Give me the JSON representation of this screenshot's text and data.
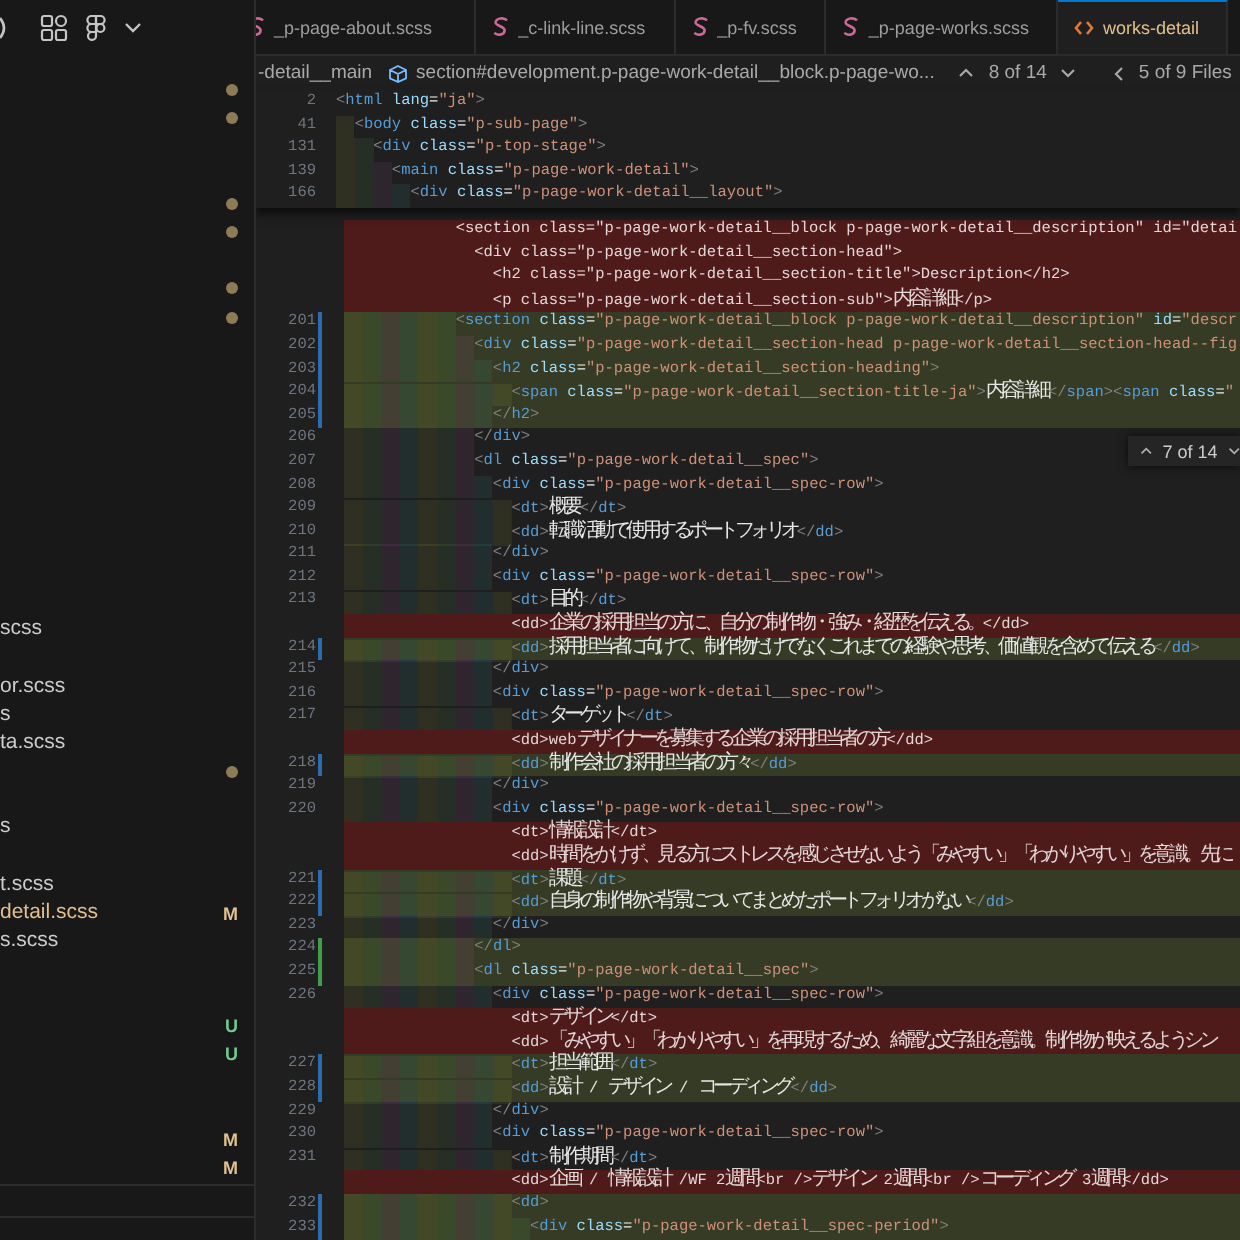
{
  "tabs": [
    {
      "label": "_p-page-about.scss",
      "kind": "scss",
      "selected": false
    },
    {
      "label": "_c-link-line.scss",
      "kind": "scss",
      "selected": false
    },
    {
      "label": "_p-fv.scss",
      "kind": "scss",
      "selected": false
    },
    {
      "label": "_p-page-works.scss",
      "kind": "scss",
      "selected": false
    },
    {
      "label": "works-detail",
      "kind": "html",
      "selected": true
    }
  ],
  "explorer": {
    "rows": [
      {
        "kind": "dot"
      },
      {
        "kind": "dot"
      },
      {
        "kind": "blank"
      },
      {
        "kind": "blank"
      },
      {
        "kind": "dot"
      },
      {
        "kind": "dot"
      },
      {
        "kind": "blank"
      },
      {
        "kind": "dot"
      },
      {
        "kind": "dot"
      },
      {
        "kind": "blank"
      },
      {
        "kind": "blank"
      },
      {
        "kind": "blank"
      },
      {
        "kind": "blank"
      },
      {
        "kind": "blank"
      },
      {
        "kind": "blank"
      },
      {
        "kind": "blank"
      },
      {
        "kind": "blank"
      },
      {
        "kind": "blank"
      },
      {
        "kind": "blank"
      },
      {
        "kind": "file",
        "label": "scss"
      },
      {
        "kind": "blank"
      },
      {
        "kind": "file",
        "label": "or.scss"
      },
      {
        "kind": "file",
        "label": "s"
      },
      {
        "kind": "file",
        "label": "ta.scss"
      },
      {
        "kind": "dot"
      },
      {
        "kind": "blank"
      },
      {
        "kind": "file",
        "label": "s"
      },
      {
        "kind": "blank"
      },
      {
        "kind": "file",
        "label": "t.scss"
      },
      {
        "kind": "file",
        "label": "detail.scss",
        "status": "M"
      },
      {
        "kind": "file",
        "label": "s.scss"
      },
      {
        "kind": "blank"
      },
      {
        "kind": "blank"
      },
      {
        "kind": "file",
        "status": "U"
      },
      {
        "kind": "file",
        "status": "U"
      },
      {
        "kind": "blank"
      },
      {
        "kind": "blank"
      },
      {
        "kind": "file",
        "status": "M"
      },
      {
        "kind": "file",
        "status": "M"
      }
    ]
  },
  "breadcrumb": [
    {
      "kind": "text",
      "label": "-detail__main"
    },
    {
      "kind": "element",
      "label": "section#development.p-page-work-detail__block.p-page-wo..."
    }
  ],
  "change_nav": {
    "position": "8 of 14"
  },
  "file_nav": {
    "position": "5 of 9 Files"
  },
  "sticky_scroll": [
    {
      "number": "2",
      "code": "<html lang=\"ja\">"
    },
    {
      "number": "41",
      "code": "  <body class=\"p-sub-page\">"
    },
    {
      "number": "131",
      "code": "    <div class=\"p-top-stage\">"
    },
    {
      "number": "139",
      "code": "      <main class=\"p-page-work-detail\">"
    },
    {
      "number": "166",
      "code": "        <div class=\"p-page-work-detail__layout\">"
    }
  ],
  "diff_lines": [
    {
      "kind": "removed",
      "code": "            <section class=\"p-page-work-detail__block p-page-work-detail__description\" id=\"detai"
    },
    {
      "kind": "removed",
      "code": "              <div class=\"p-page-work-detail__section-head\">"
    },
    {
      "kind": "removed",
      "code": "                <h2 class=\"p-page-work-detail__section-title\">Description</h2>"
    },
    {
      "kind": "removed",
      "code": "                <p class=\"p-page-work-detail__section-sub\">内容詳細</p>"
    },
    {
      "kind": "added",
      "number": "201",
      "code": "            <section class=\"p-page-work-detail__block p-page-work-detail__description\" id=\"descr"
    },
    {
      "kind": "added",
      "number": "202",
      "code": "              <div class=\"p-page-work-detail__section-head p-page-work-detail__section-head--fig"
    },
    {
      "kind": "added",
      "number": "203",
      "code": "                <h2 class=\"p-page-work-detail__section-heading\">"
    },
    {
      "kind": "added",
      "number": "204",
      "code": "                  <span class=\"p-page-work-detail__section-title-ja\">内容詳細</span><span class=\""
    },
    {
      "kind": "added",
      "number": "205",
      "code": "                </h2>"
    },
    {
      "kind": "context",
      "number": "206",
      "code": "              </div>"
    },
    {
      "kind": "context",
      "number": "207",
      "code": "              <dl class=\"p-page-work-detail__spec\">"
    },
    {
      "kind": "context",
      "number": "208",
      "code": "                <div class=\"p-page-work-detail__spec-row\">"
    },
    {
      "kind": "context",
      "number": "209",
      "code": "                  <dt>概要</dt>"
    },
    {
      "kind": "context",
      "number": "210",
      "code": "                  <dd>転職活動で使用するポートフォリオ</dd>"
    },
    {
      "kind": "context",
      "number": "211",
      "code": "                </div>"
    },
    {
      "kind": "context",
      "number": "212",
      "code": "                <div class=\"p-page-work-detail__spec-row\">"
    },
    {
      "kind": "context",
      "number": "213",
      "code": "                  <dt>目的</dt>"
    },
    {
      "kind": "removed",
      "code": "                  <dd>企業の採用担当の方に、自分の制作物・強み・経歴を伝える。</dd>"
    },
    {
      "kind": "added",
      "number": "214",
      "code": "                  <dd>採用担当者に向けて、制作物だけでなくこれまでの経験や思考、価値観を含めて伝える</dd>"
    },
    {
      "kind": "context",
      "number": "215",
      "code": "                </div>"
    },
    {
      "kind": "context",
      "number": "216",
      "code": "                <div class=\"p-page-work-detail__spec-row\">"
    },
    {
      "kind": "context",
      "number": "217",
      "code": "                  <dt>ターゲット</dt>"
    },
    {
      "kind": "removed",
      "code": "                  <dd>webデザイナーを募集する企業の採用担当者の方</dd>"
    },
    {
      "kind": "added",
      "number": "218",
      "code": "                  <dd>制作会社の採用担当者の方々</dd>"
    },
    {
      "kind": "context",
      "number": "219",
      "code": "                </div>"
    },
    {
      "kind": "context",
      "number": "220",
      "code": "                <div class=\"p-page-work-detail__spec-row\">"
    },
    {
      "kind": "removed",
      "code": "                  <dt>情報設計</dt>"
    },
    {
      "kind": "removed",
      "code": "                  <dd>時間をかけず、見る方にストレスを感じさせないよう「みやすい」「わかりやすい」を意識。先に"
    },
    {
      "kind": "added",
      "number": "221",
      "code": "                  <dt>課題</dt>"
    },
    {
      "kind": "added",
      "number": "222",
      "code": "                  <dd>自身の制作物や背景についてまとめたポートフォリオがない</dd>"
    },
    {
      "kind": "context",
      "number": "223",
      "code": "                </div>"
    },
    {
      "kind": "inserted",
      "number": "224",
      "code": "              </dl>"
    },
    {
      "kind": "inserted",
      "number": "225",
      "code": "              <dl class=\"p-page-work-detail__spec\">"
    },
    {
      "kind": "context",
      "number": "226",
      "code": "                <div class=\"p-page-work-detail__spec-row\">"
    },
    {
      "kind": "removed",
      "code": "                  <dt>デザイン</dt>"
    },
    {
      "kind": "removed",
      "code": "                  <dd>「みやすい」「わかりやすい」を再現するため、綺麗な文字組を意識。制作物が映えるようシン"
    },
    {
      "kind": "added",
      "number": "227",
      "code": "                  <dt>担当範囲</dt>"
    },
    {
      "kind": "added",
      "number": "228",
      "code": "                  <dd>設計 / デザイン / コーディング</dd>"
    },
    {
      "kind": "context",
      "number": "229",
      "code": "                </div>"
    },
    {
      "kind": "context",
      "number": "230",
      "code": "                <div class=\"p-page-work-detail__spec-row\">"
    },
    {
      "kind": "context",
      "number": "231",
      "code": "                  <dt>制作期間</dt>"
    },
    {
      "kind": "removed",
      "code": "                  <dd>企画 / 情報設計 /WF 2週間<br />デザイン 2週間<br />コーディング 3週間</dd>"
    },
    {
      "kind": "added",
      "number": "232",
      "code": "                  <dd>"
    },
    {
      "kind": "added",
      "number": "233",
      "code": "                    <div class=\"p-page-work-detail__spec-period\">"
    }
  ],
  "find_widget": {
    "position": "7 of 14"
  }
}
